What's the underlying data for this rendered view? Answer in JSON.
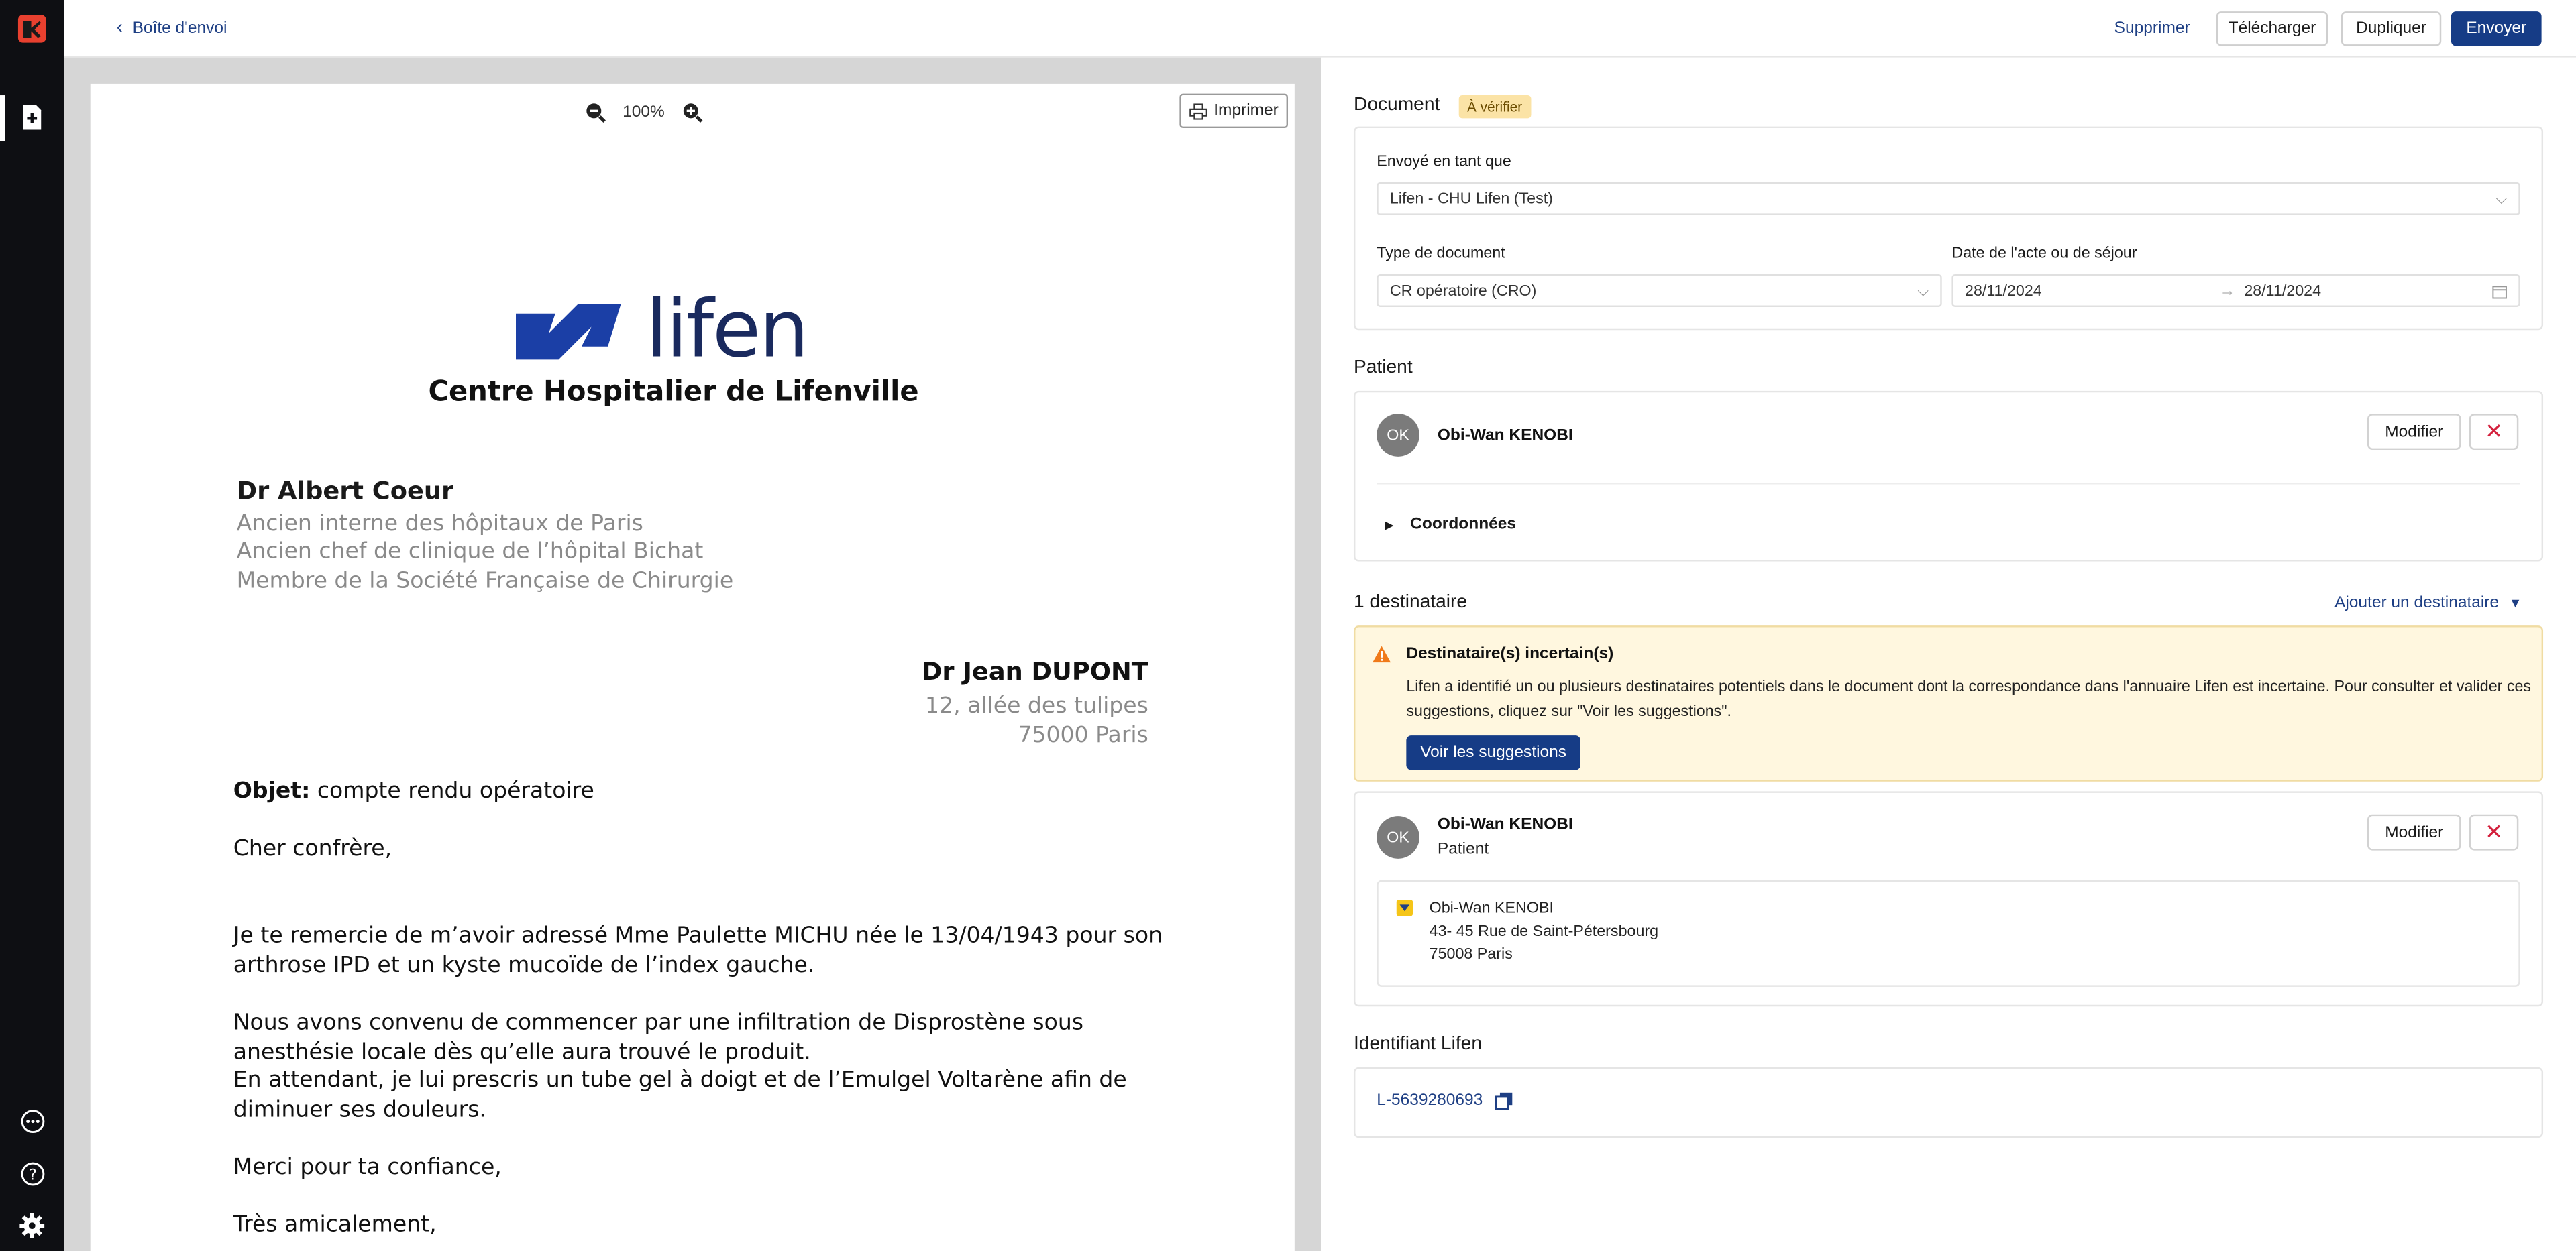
{
  "topbar": {
    "back_label": "Boîte d'envoi",
    "delete_label": "Supprimer",
    "download_label": "Télécharger",
    "duplicate_label": "Dupliquer",
    "send_label": "Envoyer"
  },
  "viewer": {
    "zoom_level": "100%",
    "print_label": "Imprimer"
  },
  "letter": {
    "logo_word": "lifen",
    "hospital": "Centre Hospitalier de Lifenville",
    "sender_name": "Dr Albert Coeur",
    "sender_lines": [
      "Ancien interne des hôpitaux de Paris",
      "Ancien chef de clinique de l’hôpital Bichat",
      "Membre de la Société Française de Chirurgie"
    ],
    "recipient_name": "Dr Jean DUPONT",
    "recipient_street": "12, allée des tulipes",
    "recipient_city": "75000 Paris",
    "subject_label": "Objet:",
    "subject": " compte rendu opératoire",
    "greeting": "Cher confrère,",
    "paragraph1": "Je te remercie de m’avoir adressé Mme Paulette MICHU née le 13/04/1943 pour son arthrose IPD et un kyste mucoïde de l’index gauche.",
    "paragraph2": "Nous avons convenu de commencer par une infiltration de Disprostène sous anesthésie locale dès qu’elle aura trouvé le produit.",
    "paragraph3": "En attendant, je lui prescris un tube gel à doigt et de l’Emulgel Voltarène afin de diminuer ses douleurs.",
    "thanks": "Merci pour ta confiance,",
    "closing": "Très amicalement,"
  },
  "document": {
    "title": "Document",
    "status_badge": "À vérifier",
    "sent_as_label": "Envoyé en tant que",
    "sent_as_value": "Lifen - CHU Lifen (Test)",
    "doc_type_label": "Type de document",
    "doc_type_value": "CR opératoire (CRO)",
    "date_label": "Date de l'acte ou de séjour",
    "date_from": "28/11/2024",
    "date_to": "28/11/2024"
  },
  "patient": {
    "title": "Patient",
    "initials": "OK",
    "name": "Obi-Wan KENOBI",
    "modify_label": "Modifier",
    "coords_label": "Coordonnées"
  },
  "recipients": {
    "title": "1 destinataire",
    "add_label": "Ajouter un destinataire",
    "warning_title": "Destinataire(s) incertain(s)",
    "warning_text": "Lifen a identifié un ou plusieurs destinataires potentiels dans le document dont la correspondance dans l'annuaire Lifen est incertaine. Pour consulter et valider ces suggestions, cliquez sur \"Voir les suggestions\".",
    "suggestions_label": "Voir les suggestions",
    "recipient_initials": "OK",
    "recipient_name": "Obi-Wan KENOBI",
    "recipient_role": "Patient",
    "modify_label": "Modifier",
    "address_name": "Obi-Wan KENOBI",
    "address_street": "43- 45 Rue de Saint-Pétersbourg",
    "address_city": "75008 Paris"
  },
  "identifier": {
    "title": "Identifiant Lifen",
    "value": "L-5639280693"
  },
  "colors": {
    "brand_blue": "#163c86",
    "logo_red": "#e8402f",
    "danger_red": "#d4213d",
    "warning_bg": "#fff7df",
    "warning_icon": "#f07a1a"
  }
}
